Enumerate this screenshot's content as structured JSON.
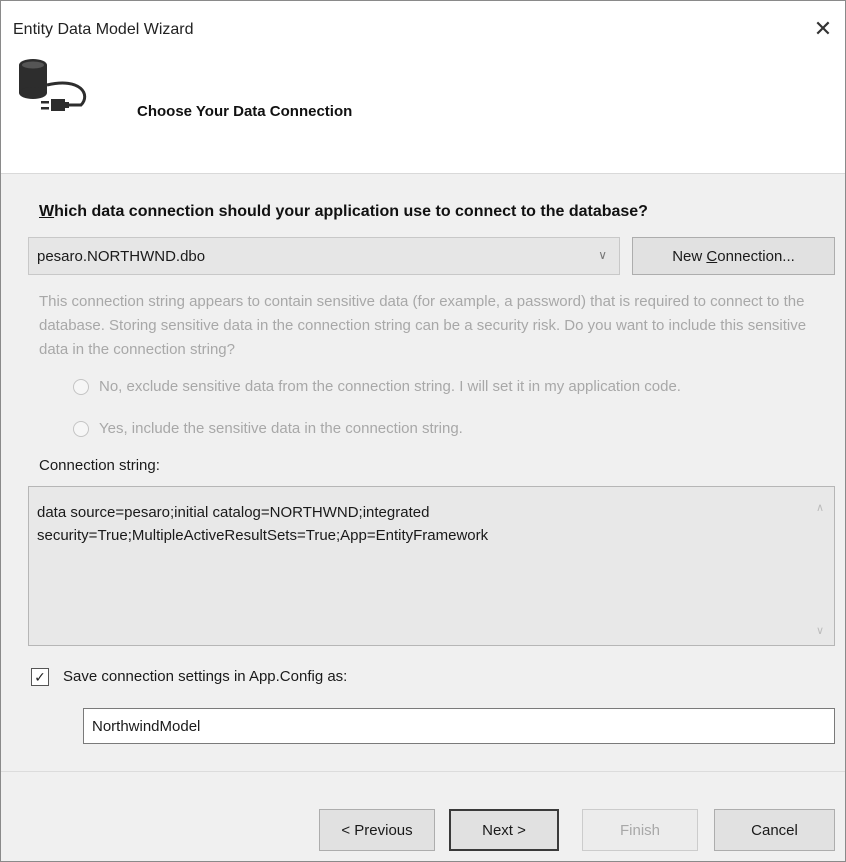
{
  "window": {
    "title": "Entity Data Model Wizard",
    "close_glyph": "✕"
  },
  "header": {
    "title": "Choose Your Data Connection",
    "icon": "database-plug-icon"
  },
  "question": {
    "mnemonic": "W",
    "rest": "hich data connection should your application use to connect to the database?"
  },
  "connection_select": {
    "value": "pesaro.NORTHWND.dbo",
    "chevron": "∨"
  },
  "new_connection_button": {
    "before": "New ",
    "mnemonic": "C",
    "after": "onnection..."
  },
  "sensitive_notice": "This connection string appears to contain sensitive data (for example, a password) that is required to connect to the database. Storing sensitive data in the connection string can be a security risk. Do you want to include this sensitive data in the connection string?",
  "radio_options": [
    {
      "label": "No, exclude sensitive data from the connection string. I will set it in my application code."
    },
    {
      "label": "Yes, include the sensitive data in the connection string."
    }
  ],
  "connection_string": {
    "label": "Connection string:",
    "value": "data source=pesaro;initial catalog=NORTHWND;integrated security=True;MultipleActiveResultSets=True;App=EntityFramework",
    "scroll_up": "∧",
    "scroll_down": "∨"
  },
  "save_settings": {
    "checked": true,
    "check_glyph": "✓",
    "label": "Save connection settings in App.Config as:",
    "name_value": "NorthwindModel"
  },
  "buttons": {
    "previous": "< Previous",
    "next": "Next >",
    "finish": "Finish",
    "cancel": "Cancel"
  }
}
